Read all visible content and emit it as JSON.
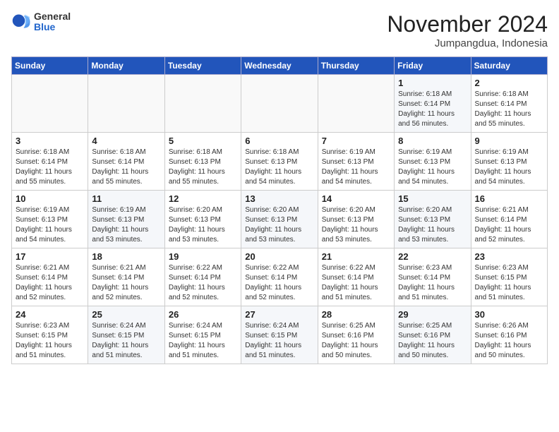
{
  "logo": {
    "general": "General",
    "blue": "Blue"
  },
  "title": "November 2024",
  "subtitle": "Jumpangdua, Indonesia",
  "weekdays": [
    "Sunday",
    "Monday",
    "Tuesday",
    "Wednesday",
    "Thursday",
    "Friday",
    "Saturday"
  ],
  "weeks": [
    [
      {
        "day": "",
        "info": ""
      },
      {
        "day": "",
        "info": ""
      },
      {
        "day": "",
        "info": ""
      },
      {
        "day": "",
        "info": ""
      },
      {
        "day": "",
        "info": ""
      },
      {
        "day": "1",
        "info": "Sunrise: 6:18 AM\nSunset: 6:14 PM\nDaylight: 11 hours\nand 56 minutes."
      },
      {
        "day": "2",
        "info": "Sunrise: 6:18 AM\nSunset: 6:14 PM\nDaylight: 11 hours\nand 55 minutes."
      }
    ],
    [
      {
        "day": "3",
        "info": "Sunrise: 6:18 AM\nSunset: 6:14 PM\nDaylight: 11 hours\nand 55 minutes."
      },
      {
        "day": "4",
        "info": "Sunrise: 6:18 AM\nSunset: 6:14 PM\nDaylight: 11 hours\nand 55 minutes."
      },
      {
        "day": "5",
        "info": "Sunrise: 6:18 AM\nSunset: 6:13 PM\nDaylight: 11 hours\nand 55 minutes."
      },
      {
        "day": "6",
        "info": "Sunrise: 6:18 AM\nSunset: 6:13 PM\nDaylight: 11 hours\nand 54 minutes."
      },
      {
        "day": "7",
        "info": "Sunrise: 6:19 AM\nSunset: 6:13 PM\nDaylight: 11 hours\nand 54 minutes."
      },
      {
        "day": "8",
        "info": "Sunrise: 6:19 AM\nSunset: 6:13 PM\nDaylight: 11 hours\nand 54 minutes."
      },
      {
        "day": "9",
        "info": "Sunrise: 6:19 AM\nSunset: 6:13 PM\nDaylight: 11 hours\nand 54 minutes."
      }
    ],
    [
      {
        "day": "10",
        "info": "Sunrise: 6:19 AM\nSunset: 6:13 PM\nDaylight: 11 hours\nand 54 minutes."
      },
      {
        "day": "11",
        "info": "Sunrise: 6:19 AM\nSunset: 6:13 PM\nDaylight: 11 hours\nand 53 minutes."
      },
      {
        "day": "12",
        "info": "Sunrise: 6:20 AM\nSunset: 6:13 PM\nDaylight: 11 hours\nand 53 minutes."
      },
      {
        "day": "13",
        "info": "Sunrise: 6:20 AM\nSunset: 6:13 PM\nDaylight: 11 hours\nand 53 minutes."
      },
      {
        "day": "14",
        "info": "Sunrise: 6:20 AM\nSunset: 6:13 PM\nDaylight: 11 hours\nand 53 minutes."
      },
      {
        "day": "15",
        "info": "Sunrise: 6:20 AM\nSunset: 6:13 PM\nDaylight: 11 hours\nand 53 minutes."
      },
      {
        "day": "16",
        "info": "Sunrise: 6:21 AM\nSunset: 6:14 PM\nDaylight: 11 hours\nand 52 minutes."
      }
    ],
    [
      {
        "day": "17",
        "info": "Sunrise: 6:21 AM\nSunset: 6:14 PM\nDaylight: 11 hours\nand 52 minutes."
      },
      {
        "day": "18",
        "info": "Sunrise: 6:21 AM\nSunset: 6:14 PM\nDaylight: 11 hours\nand 52 minutes."
      },
      {
        "day": "19",
        "info": "Sunrise: 6:22 AM\nSunset: 6:14 PM\nDaylight: 11 hours\nand 52 minutes."
      },
      {
        "day": "20",
        "info": "Sunrise: 6:22 AM\nSunset: 6:14 PM\nDaylight: 11 hours\nand 52 minutes."
      },
      {
        "day": "21",
        "info": "Sunrise: 6:22 AM\nSunset: 6:14 PM\nDaylight: 11 hours\nand 51 minutes."
      },
      {
        "day": "22",
        "info": "Sunrise: 6:23 AM\nSunset: 6:14 PM\nDaylight: 11 hours\nand 51 minutes."
      },
      {
        "day": "23",
        "info": "Sunrise: 6:23 AM\nSunset: 6:15 PM\nDaylight: 11 hours\nand 51 minutes."
      }
    ],
    [
      {
        "day": "24",
        "info": "Sunrise: 6:23 AM\nSunset: 6:15 PM\nDaylight: 11 hours\nand 51 minutes."
      },
      {
        "day": "25",
        "info": "Sunrise: 6:24 AM\nSunset: 6:15 PM\nDaylight: 11 hours\nand 51 minutes."
      },
      {
        "day": "26",
        "info": "Sunrise: 6:24 AM\nSunset: 6:15 PM\nDaylight: 11 hours\nand 51 minutes."
      },
      {
        "day": "27",
        "info": "Sunrise: 6:24 AM\nSunset: 6:15 PM\nDaylight: 11 hours\nand 51 minutes."
      },
      {
        "day": "28",
        "info": "Sunrise: 6:25 AM\nSunset: 6:16 PM\nDaylight: 11 hours\nand 50 minutes."
      },
      {
        "day": "29",
        "info": "Sunrise: 6:25 AM\nSunset: 6:16 PM\nDaylight: 11 hours\nand 50 minutes."
      },
      {
        "day": "30",
        "info": "Sunrise: 6:26 AM\nSunset: 6:16 PM\nDaylight: 11 hours\nand 50 minutes."
      }
    ]
  ]
}
